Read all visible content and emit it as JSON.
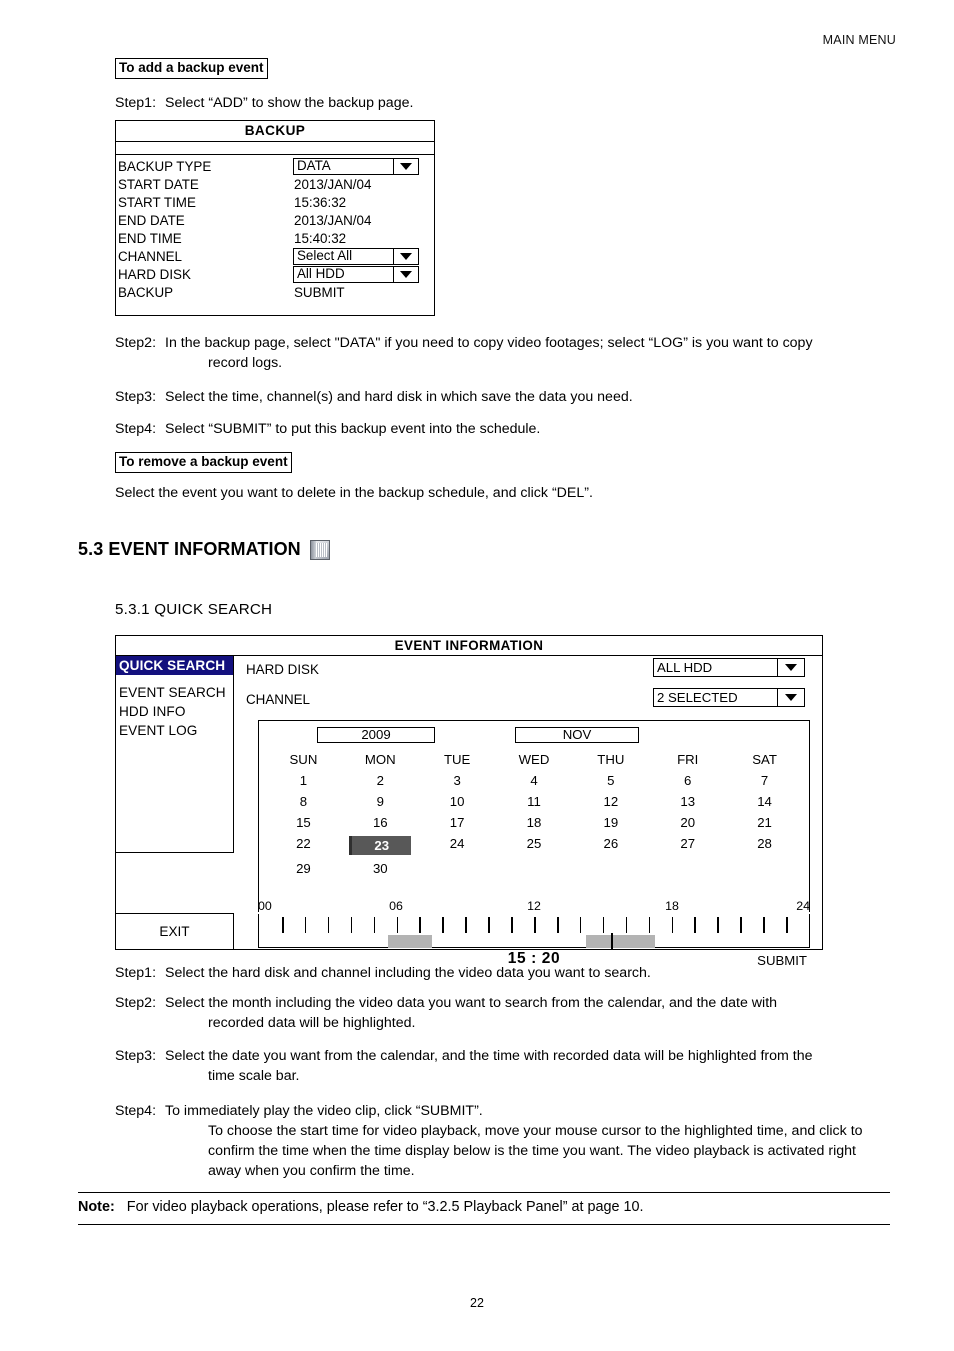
{
  "page": {
    "header": "MAIN MENU",
    "number": "22"
  },
  "backup_section": {
    "heading": "To add a backup event",
    "step1": {
      "label": "Step1:",
      "text": "Select “ADD” to show the backup page."
    },
    "dialog": {
      "title": "BACKUP",
      "rows": [
        {
          "label": "BACKUP TYPE",
          "value": "DATA",
          "control": "dropdown"
        },
        {
          "label": "START DATE",
          "value": "2013/JAN/04",
          "control": "text"
        },
        {
          "label": "START TIME",
          "value": "15:36:32",
          "control": "text"
        },
        {
          "label": "END DATE",
          "value": "2013/JAN/04",
          "control": "text"
        },
        {
          "label": "END TIME",
          "value": "15:40:32",
          "control": "text"
        },
        {
          "label": "CHANNEL",
          "value": "Select All",
          "control": "dropdown"
        },
        {
          "label": "HARD DISK",
          "value": "All HDD",
          "control": "dropdown"
        },
        {
          "label": "BACKUP",
          "value": "SUBMIT",
          "control": "button"
        }
      ]
    },
    "step2": {
      "label": "Step2:",
      "line1": "In the backup page, select \"DATA\" if you need to copy video footages; select “LOG” is you want to copy",
      "line2": "record logs."
    },
    "step3": {
      "label": "Step3:",
      "text": "Select the time, channel(s) and hard disk in which save the data you need."
    },
    "step4": {
      "label": "Step4:",
      "text": "Select “SUBMIT” to put this backup event into the schedule."
    },
    "remove_heading": "To remove a backup event",
    "remove_text": "Select the event you want to delete in the backup schedule, and click “DEL”."
  },
  "section": {
    "number_title": "5.3 EVENT INFORMATION",
    "icon": "document-list-icon",
    "subsection": "5.3.1 QUICK SEARCH"
  },
  "event_info": {
    "title": "EVENT INFORMATION",
    "sidebar": [
      {
        "label": "QUICK SEARCH",
        "active": true
      },
      {
        "label": "EVENT SEARCH",
        "active": false
      },
      {
        "label": "HDD INFO",
        "active": false
      },
      {
        "label": "EVENT LOG",
        "active": false
      }
    ],
    "exit_label": "EXIT",
    "fields": {
      "hard_disk_label": "HARD DISK",
      "hard_disk_value": "ALL HDD",
      "channel_label": "CHANNEL",
      "channel_value": "2 SELECTED"
    },
    "calendar": {
      "year": "2009",
      "month": "NOV",
      "dow": [
        "SUN",
        "MON",
        "TUE",
        "WED",
        "THU",
        "FRI",
        "SAT"
      ],
      "weeks": [
        [
          "1",
          "2",
          "3",
          "4",
          "5",
          "6",
          "7"
        ],
        [
          "8",
          "9",
          "10",
          "11",
          "12",
          "13",
          "14"
        ],
        [
          "15",
          "16",
          "17",
          "18",
          "19",
          "20",
          "21"
        ],
        [
          "22",
          "23",
          "24",
          "25",
          "26",
          "27",
          "28"
        ],
        [
          "29",
          "30",
          "",
          "",
          "",
          "",
          ""
        ]
      ],
      "selected_day": "23",
      "selected_color": "#585858"
    },
    "timescale": {
      "tick_labels": [
        "00",
        "06",
        "12",
        "18",
        "24"
      ],
      "tick_label_positions": [
        0,
        25,
        50,
        75,
        100
      ],
      "minor_ticks": 23,
      "recorded_blocks": [
        {
          "start_pct": 23.5,
          "width_pct": 8.0
        },
        {
          "start_pct": 59.5,
          "width_pct": 12.5
        }
      ],
      "cursor_pct": 64.0,
      "time_display": "15 : 20",
      "submit_label": "SUBMIT"
    }
  },
  "quick_search_steps": {
    "step1": {
      "label": "Step1:",
      "text": "Select the hard disk and channel including the video data you want to search."
    },
    "step2": {
      "label": "Step2:",
      "line1": "Select the month including the video data you want to search from the calendar, and the date with",
      "line2": "recorded data will be highlighted."
    },
    "step3": {
      "label": "Step3:",
      "line1": "Select the date you want from the calendar, and the time with recorded data will be highlighted from the",
      "line2": "time scale bar."
    },
    "step4": {
      "label": "Step4:",
      "line1": "To immediately play the video clip, click “SUBMIT”.",
      "line2": "To choose the start time for video playback, move your mouse cursor to the highlighted time, and click to",
      "line3": "confirm the time when the time display below is the time you want. The video playback is activated right",
      "line4": "away when you confirm the time."
    }
  },
  "note": {
    "label": "Note:",
    "text": "For video playback operations, please refer to “3.2.5 Playback Panel” at page 10."
  }
}
